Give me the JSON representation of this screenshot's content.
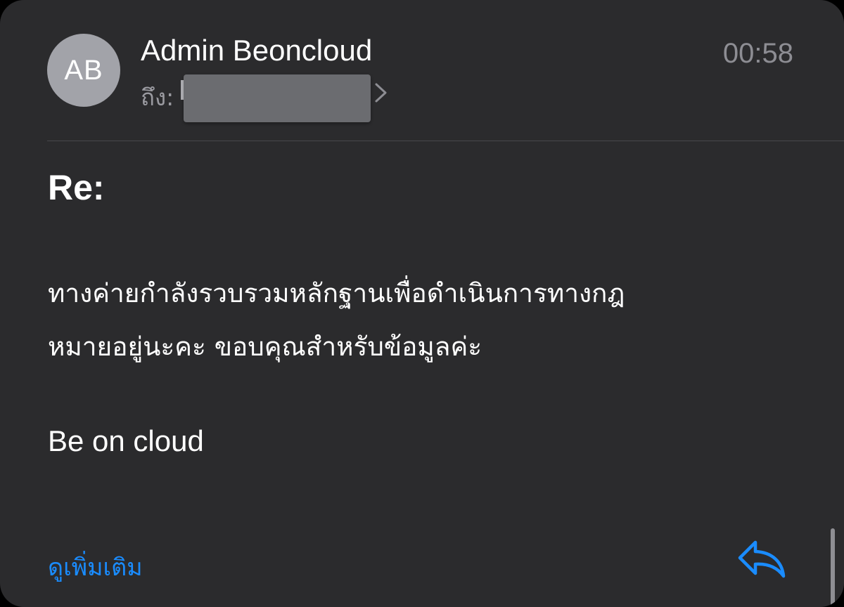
{
  "email": {
    "avatar_initials": "AB",
    "sender_name": "Admin Beoncloud",
    "time": "00:58",
    "to_label": "ถึง:",
    "subject": "Re:",
    "body_lines": [
      "ทางค่ายกำลังรวบรวมหลักฐานเพื่อดำเนินการทางกฎ",
      "หมายอยู่นะคะ ขอบคุณสำหรับข้อมูลค่ะ"
    ],
    "signature": "Be on cloud",
    "see_more_label": "ดูเพิ่มเติม"
  },
  "icons": {
    "recipient_chevron": "chevron-right-icon",
    "reply": "reply-arrow-icon"
  },
  "colors": {
    "background": "#2b2b2d",
    "avatar": "#a2a3a9",
    "secondary_text": "#8d8d93",
    "accent": "#1a8cff",
    "redaction": "#6b6c70"
  }
}
